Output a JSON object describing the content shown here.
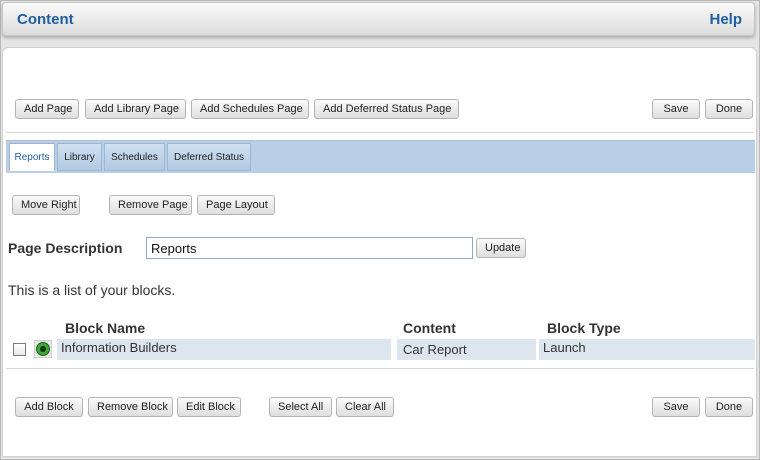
{
  "header": {
    "title": "Content",
    "help": "Help"
  },
  "toolbar_top": {
    "add_page": "Add Page",
    "add_library_page": "Add Library Page",
    "add_schedules_page": "Add Schedules Page",
    "add_deferred_status_page": "Add Deferred Status Page",
    "save": "Save",
    "done": "Done"
  },
  "tabs": [
    {
      "label": "Reports",
      "active": true
    },
    {
      "label": "Library",
      "active": false
    },
    {
      "label": "Schedules",
      "active": false
    },
    {
      "label": "Deferred Status",
      "active": false
    }
  ],
  "page_actions": {
    "move_right": "Move Right",
    "remove_page": "Remove Page",
    "page_layout": "Page Layout"
  },
  "page_description": {
    "label": "Page Description",
    "value": "Reports",
    "update": "Update"
  },
  "blocks": {
    "intro": "This is a list of your blocks.",
    "columns": {
      "name": "Block Name",
      "content": "Content",
      "type": "Block Type"
    },
    "rows": [
      {
        "checked": false,
        "icon": "launch-icon",
        "name": "Information Builders",
        "content": "Car Report",
        "type": "Launch"
      }
    ]
  },
  "toolbar_bottom": {
    "add_block": "Add Block",
    "remove_block": "Remove Block",
    "edit_block": "Edit Block",
    "select_all": "Select All",
    "clear_all": "Clear All",
    "save": "Save",
    "done": "Done"
  },
  "colors": {
    "accent": "#1f5e9f",
    "tab_bar": "#b9cfe6",
    "row_bg": "#dde5ee"
  }
}
